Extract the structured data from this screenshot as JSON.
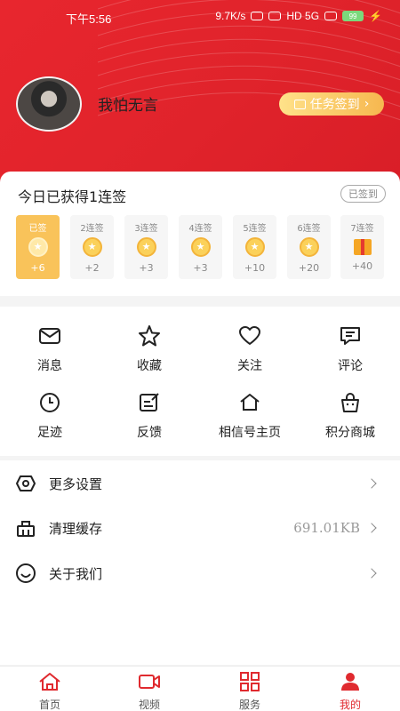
{
  "status_bar": {
    "time": "下午5:56",
    "net_speed": "9.7K/s",
    "network_label": "HD 5G",
    "battery": "99"
  },
  "profile": {
    "username": "我怕无言",
    "task_button": "任务签到"
  },
  "checkin": {
    "title": "今日已获得1连签",
    "signed_badge": "已签到",
    "days": [
      {
        "label": "已签",
        "points": "+6",
        "active": true,
        "reward": "coin"
      },
      {
        "label": "2连签",
        "points": "+2",
        "active": false,
        "reward": "coin"
      },
      {
        "label": "3连签",
        "points": "+3",
        "active": false,
        "reward": "coin"
      },
      {
        "label": "4连签",
        "points": "+3",
        "active": false,
        "reward": "coin"
      },
      {
        "label": "5连签",
        "points": "+10",
        "active": false,
        "reward": "coin"
      },
      {
        "label": "6连签",
        "points": "+20",
        "active": false,
        "reward": "coin"
      },
      {
        "label": "7连签",
        "points": "+40",
        "active": false,
        "reward": "gift"
      }
    ]
  },
  "menu_grid": [
    {
      "label": "消息",
      "icon": "envelope-icon"
    },
    {
      "label": "收藏",
      "icon": "star-icon"
    },
    {
      "label": "关注",
      "icon": "heart-icon"
    },
    {
      "label": "评论",
      "icon": "comment-icon"
    },
    {
      "label": "足迹",
      "icon": "clock-icon"
    },
    {
      "label": "反馈",
      "icon": "feedback-icon"
    },
    {
      "label": "相信号主页",
      "icon": "home-icon"
    },
    {
      "label": "积分商城",
      "icon": "shopping-bag-icon"
    }
  ],
  "settings_list": [
    {
      "label": "更多设置",
      "value": "",
      "icon": "settings-icon"
    },
    {
      "label": "清理缓存",
      "value": "691.01KB",
      "icon": "broom-icon"
    },
    {
      "label": "关于我们",
      "value": "",
      "icon": "smile-icon"
    }
  ],
  "bottom_nav": [
    {
      "label": "首页",
      "icon": "home-icon",
      "active": false
    },
    {
      "label": "视频",
      "icon": "video-icon",
      "active": false
    },
    {
      "label": "服务",
      "icon": "grid-icon",
      "active": false
    },
    {
      "label": "我的",
      "icon": "user-icon",
      "active": true
    }
  ],
  "colors": {
    "brand_red": "#e0232b",
    "gold": "#f9c35a",
    "active_nav": "#e02a2f"
  }
}
